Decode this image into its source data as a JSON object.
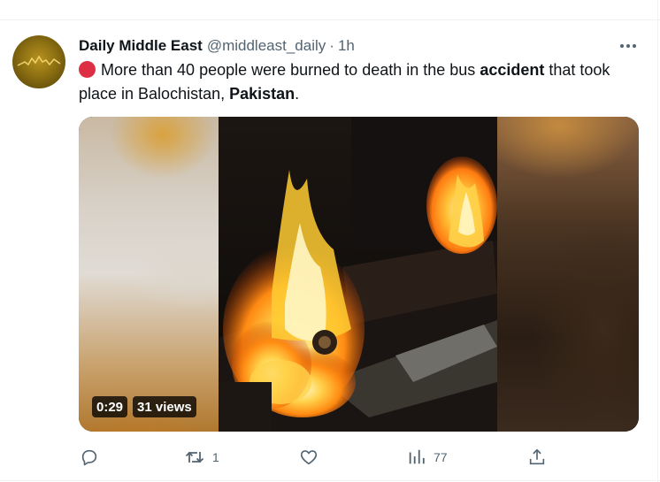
{
  "post": {
    "author_name": "Daily Middle East",
    "handle": "@middleast_daily",
    "separator": "·",
    "time": "1h",
    "text_parts": {
      "emoji": "red-circle-icon",
      "part1": "More than 40 people were burned to death in the bus ",
      "bold1": "accident",
      "part2": " that took place in Balochistan, ",
      "bold2": "Pakistan",
      "part3": "."
    }
  },
  "media": {
    "duration": "0:29",
    "views": "31 views"
  },
  "actions": {
    "reply_icon": "reply-icon",
    "repost_icon": "repost-icon",
    "repost_count": "1",
    "like_icon": "like-icon",
    "views_icon": "views-chart-icon",
    "views_count": "77",
    "share_icon": "share-icon",
    "more_icon": "more-icon"
  },
  "colors": {
    "text_primary": "#0f1419",
    "text_secondary": "#536471",
    "red_circle": "#dd2e44"
  }
}
